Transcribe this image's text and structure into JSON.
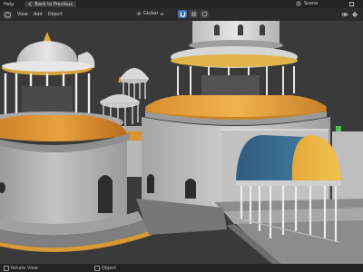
{
  "topbar": {
    "help_label": "Help",
    "back_label": "Back to Previous",
    "scene_label": "Scene"
  },
  "header": {
    "menus": [
      "View",
      "Add",
      "Object"
    ],
    "pivot_label": "Global"
  },
  "statusbar": {
    "items": [
      "Rotate View",
      "Object"
    ]
  },
  "colors": {
    "viewport_bg": "#3a3a3a",
    "roof_gold": "#e0a635",
    "dome_orange": "#dc8a2c",
    "stone_gray": "#b9b9b9",
    "awning_blue": "#3b6e96",
    "accent_blue": "#4772b3"
  }
}
